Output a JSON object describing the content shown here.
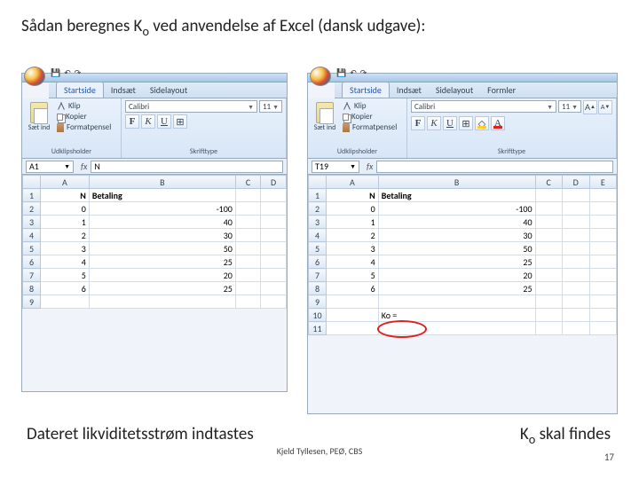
{
  "title_before_sub": "Sådan beregnes K",
  "title_sub": "o",
  "title_after_sub": " ved anvendelse af Excel (dansk udgave):",
  "caption_left": "Dateret likviditetsstrøm indtastes",
  "caption_right_before": "K",
  "caption_right_sub": "o",
  "caption_right_after": " skal findes",
  "footer": "Kjeld Tyllesen, PEØ, CBS",
  "page_number": "17",
  "excel_left": {
    "tabs": [
      "Startside",
      "Indsæt",
      "Sidelayout"
    ],
    "active_tab": 0,
    "clipboard": {
      "paste": "Sæt ind",
      "cut": "Klip",
      "copy": "Kopier",
      "format_painter": "Formatpensel",
      "group_label": "Udklipsholder"
    },
    "font": {
      "name": "Calibri",
      "size": "11",
      "bold": "F",
      "italic": "K",
      "underline": "U",
      "group_label": "Skrifttype"
    },
    "name_box": "A1",
    "fx": "fx",
    "formula_value": "N",
    "columns": [
      "A",
      "B",
      "C",
      "D"
    ],
    "header_row": {
      "A": "N",
      "B": "Betaling"
    },
    "data": [
      {
        "n": "0",
        "b": "-100"
      },
      {
        "n": "1",
        "b": "40"
      },
      {
        "n": "2",
        "b": "30"
      },
      {
        "n": "3",
        "b": "50"
      },
      {
        "n": "4",
        "b": "25"
      },
      {
        "n": "5",
        "b": "20"
      },
      {
        "n": "6",
        "b": "25"
      }
    ],
    "last_row": "9"
  },
  "excel_right": {
    "tabs": [
      "Startside",
      "Indsæt",
      "Sidelayout",
      "Formler"
    ],
    "active_tab": 0,
    "clipboard": {
      "paste": "Sæt ind",
      "cut": "Klip",
      "copy": "Kopier",
      "format_painter": "Formatpensel",
      "group_label": "Udklipsholder"
    },
    "font": {
      "name": "Calibri",
      "size": "11",
      "bold": "F",
      "italic": "K",
      "underline": "U",
      "grow": "A",
      "shrink": "A",
      "font_color": "A",
      "group_label": "Skrifttype"
    },
    "name_box": "T19",
    "fx": "fx",
    "formula_value": "",
    "columns": [
      "A",
      "B",
      "C",
      "D",
      "E"
    ],
    "header_row": {
      "A": "N",
      "B": "Betaling"
    },
    "data": [
      {
        "n": "0",
        "b": "-100"
      },
      {
        "n": "1",
        "b": "40"
      },
      {
        "n": "2",
        "b": "30"
      },
      {
        "n": "3",
        "b": "50"
      },
      {
        "n": "4",
        "b": "25"
      },
      {
        "n": "5",
        "b": "20"
      },
      {
        "n": "6",
        "b": "25"
      }
    ],
    "ko_label": "Ko =",
    "row_count": 11
  }
}
